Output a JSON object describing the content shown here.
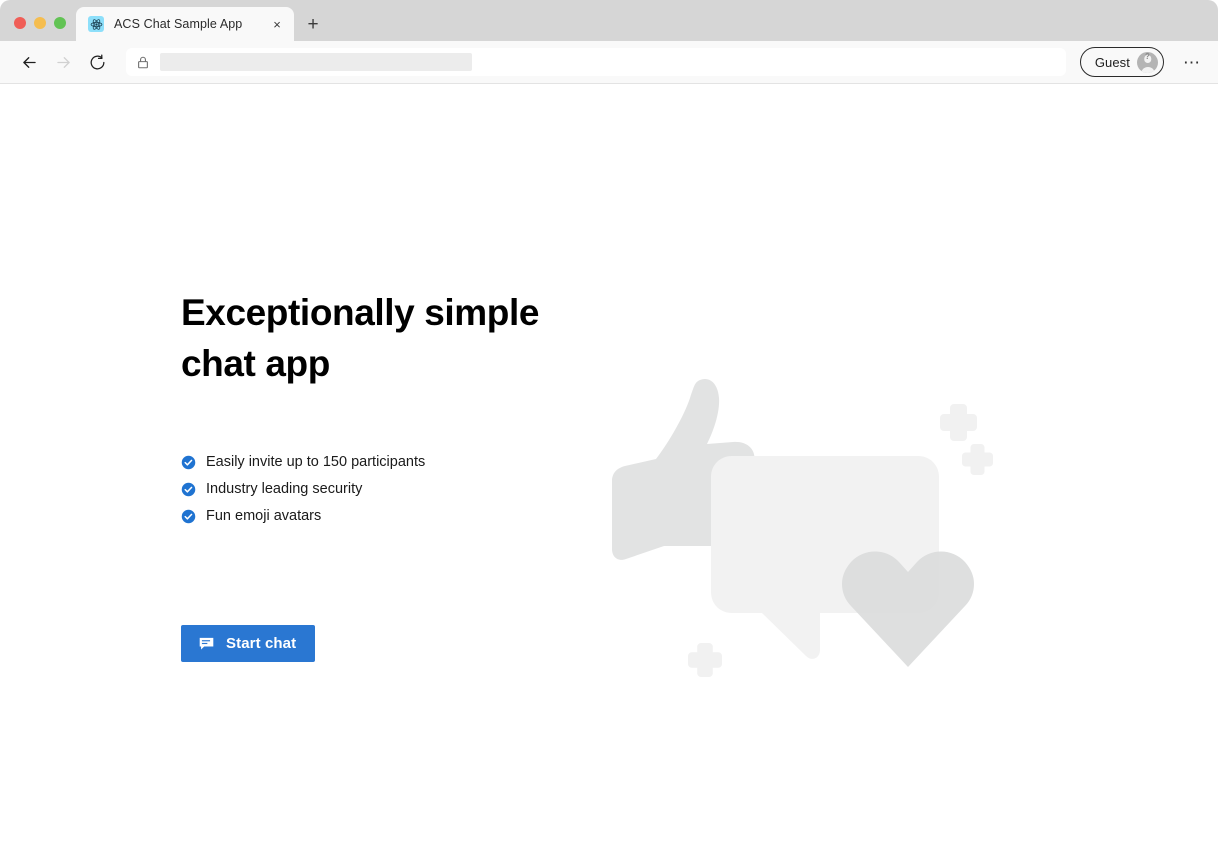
{
  "browser": {
    "traffic_lights": [
      {
        "name": "close",
        "color": "#f05e57"
      },
      {
        "name": "minimize",
        "color": "#f5bd4f"
      },
      {
        "name": "maximize",
        "color": "#62c354"
      }
    ],
    "tab": {
      "title": "ACS Chat Sample App",
      "favicon": "react-logo-icon",
      "close_label": "×"
    },
    "new_tab_label": "+",
    "nav": {
      "back_icon": "back-arrow-icon",
      "forward_icon": "forward-arrow-icon",
      "reload_icon": "reload-icon"
    },
    "omnibox": {
      "lock_icon": "lock-icon",
      "value": "",
      "placeholder": "",
      "redacted": true
    },
    "profile": {
      "label": "Guest",
      "avatar_icon": "guest-avatar-icon",
      "badge": "?"
    },
    "more_label": "⋯"
  },
  "page": {
    "title_line_1": "Exceptionally simple",
    "title_line_2": "chat app",
    "features": [
      {
        "icon": "check-circle-icon",
        "label": "Easily invite up to 150 participants"
      },
      {
        "icon": "check-circle-icon",
        "label": "Industry leading security"
      },
      {
        "icon": "check-circle-icon",
        "label": "Fun emoji avatars"
      }
    ],
    "start_chat": {
      "label": "Start chat",
      "icon": "chat-bubble-icon"
    },
    "illustration": {
      "shapes": [
        "thumbs-up",
        "speech-bubble",
        "heart",
        "sparkle-plus",
        "sparkle-plus",
        "sparkle-plus"
      ]
    }
  },
  "colors": {
    "accent": "#2a77d2",
    "check": "#1f73d1",
    "art_light": "#f2f2f2",
    "art_mid": "#e2e3e3",
    "text": "#000000",
    "chrome_tabstrip": "#d6d6d6",
    "chrome_toolbar": "#f9f9f9"
  }
}
